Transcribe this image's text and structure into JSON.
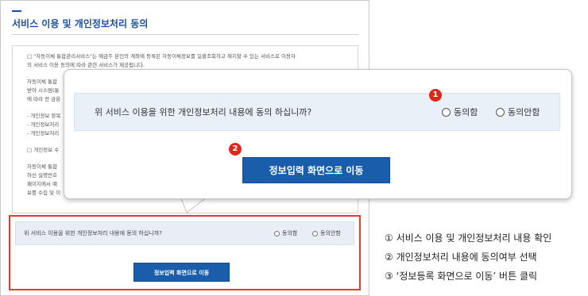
{
  "page": {
    "title": "서비스 이용 및 개인정보처리 동의",
    "terms_lines": [
      "□ \"자동이체 통합관리서비스\"는 예금주 본인의 계좌에 등록된 자동이체정보를 일괄조회하고 해지할 수 있는 서비스로 이용자",
      "의 서비스 이용 동의에 따라 관련 서비스가 제공됩니다.",
      "",
      "자동이체 통합",
      "받아 시스템(통",
      "에 따라 전 금융",
      "",
      "- 개인정보 항목",
      "- 개인정보처리",
      "- 개인정보처리",
      "",
      "□ 개인정보 수",
      "",
      "자동이체 통합",
      "하신 실명번호",
      "페이지에서 예",
      "보를 수집 및 이"
    ]
  },
  "consent": {
    "question": "위 서비스 이용을 위한 개인정보처리 내용에 동의 하십니까?",
    "agree_label": "동의함",
    "disagree_label": "동의안함",
    "submit_label": "정보입력 화면으로 이동"
  },
  "callouts": {
    "badge_1": "1",
    "badge_2": "2"
  },
  "steps": [
    "① 서비스 이용 및 개인정보처리 내용 확인",
    "② 개인정보처리 내용에 동의여부 선택",
    "③ ‘정보등록 화면으로 이동’ 버튼 클릭"
  ],
  "colors": {
    "accent_blue": "#1a5dab",
    "title_blue": "#1a4f9c",
    "highlight_red": "#e23b2f",
    "question_bg": "#eaf0f8"
  }
}
